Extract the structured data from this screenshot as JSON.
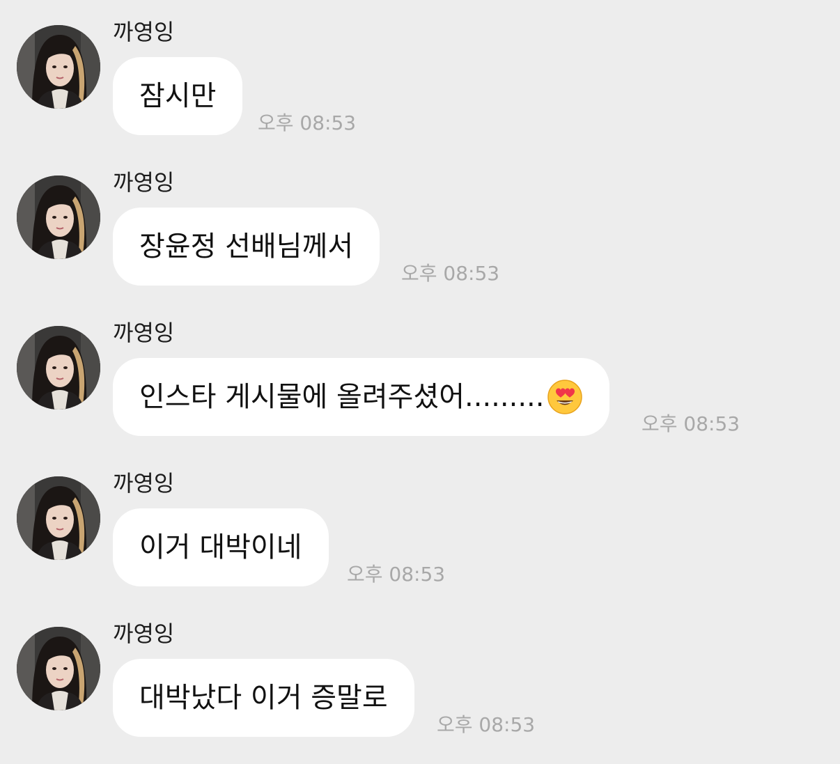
{
  "theme": {
    "background": "#ededed",
    "bubble_color": "#ffffff",
    "time_color": "#a8a8a8"
  },
  "messages": [
    {
      "sender": "까영잉",
      "avatar_icon": "profile-photo",
      "text": "잠시만",
      "emoji": "",
      "time": "오후 08:53"
    },
    {
      "sender": "까영잉",
      "avatar_icon": "profile-photo",
      "text": "장윤정 선배님께서",
      "emoji": "",
      "time": "오후 08:53"
    },
    {
      "sender": "까영잉",
      "avatar_icon": "profile-photo",
      "text": "인스타 게시물에 올려주셨어.........",
      "emoji": "heart-eyes-emoji",
      "time": "오후 08:53"
    },
    {
      "sender": "까영잉",
      "avatar_icon": "profile-photo",
      "text": "이거 대박이네",
      "emoji": "",
      "time": "오후 08:53"
    },
    {
      "sender": "까영잉",
      "avatar_icon": "profile-photo",
      "text": "대박났다 이거 증말로",
      "emoji": "",
      "time": "오후 08:53"
    }
  ]
}
